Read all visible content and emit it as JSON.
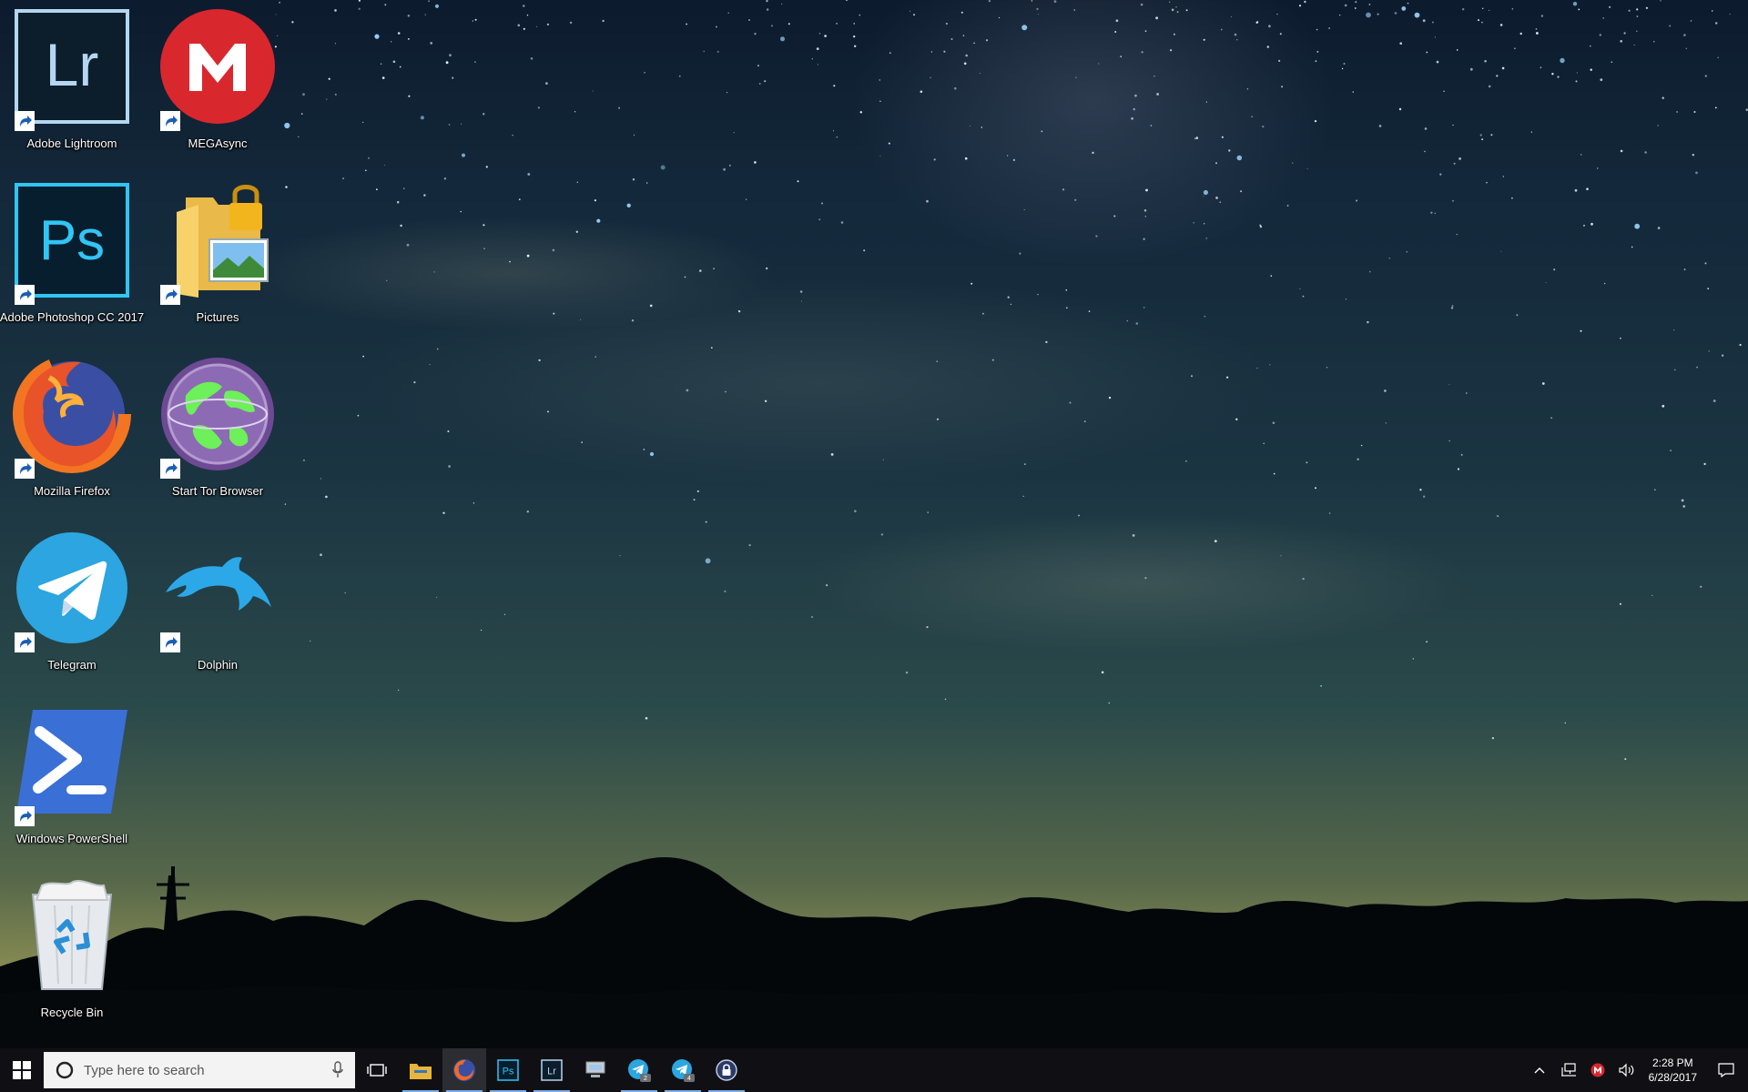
{
  "desktop": {
    "icons": [
      {
        "label": "Adobe Lightroom",
        "icon": "lightroom-icon"
      },
      {
        "label": "MEGAsync",
        "icon": "mega-icon"
      },
      {
        "label": "Adobe Photoshop CC 2017",
        "icon": "photoshop-icon"
      },
      {
        "label": "Pictures",
        "icon": "locked-folder-icon"
      },
      {
        "label": "Mozilla Firefox",
        "icon": "firefox-icon"
      },
      {
        "label": "Start Tor Browser",
        "icon": "tor-browser-icon"
      },
      {
        "label": "Telegram",
        "icon": "telegram-icon"
      },
      {
        "label": "Dolphin",
        "icon": "dolphin-icon"
      },
      {
        "label": "Windows PowerShell",
        "icon": "powershell-icon"
      },
      {
        "label": "Recycle Bin",
        "icon": "recycle-bin-icon"
      }
    ],
    "lightroom_text": "Lr",
    "photoshop_text": "Ps"
  },
  "taskbar": {
    "search_placeholder": "Type here to search",
    "pinned": [
      {
        "icon": "file-explorer-icon"
      },
      {
        "icon": "firefox-icon",
        "active": true
      },
      {
        "icon": "photoshop-icon",
        "text": "Ps"
      },
      {
        "icon": "lightroom-icon",
        "text": "Lr"
      },
      {
        "icon": "network-drive-icon"
      },
      {
        "icon": "telegram-icon",
        "badge": "2"
      },
      {
        "icon": "telegram-icon",
        "badge": "4"
      },
      {
        "icon": "password-lock-icon"
      }
    ],
    "tray": {
      "time": "2:28 PM",
      "date": "6/28/2017"
    }
  },
  "colors": {
    "taskbar_bg": "#101014",
    "running_underline": "#7aaee6",
    "lightroom_blue": "#b4d6f0",
    "photoshop_cyan": "#31c5f4",
    "mega_red": "#d9272e",
    "telegram_blue": "#2ca5e0",
    "powershell_blue": "#3a6fd6"
  }
}
